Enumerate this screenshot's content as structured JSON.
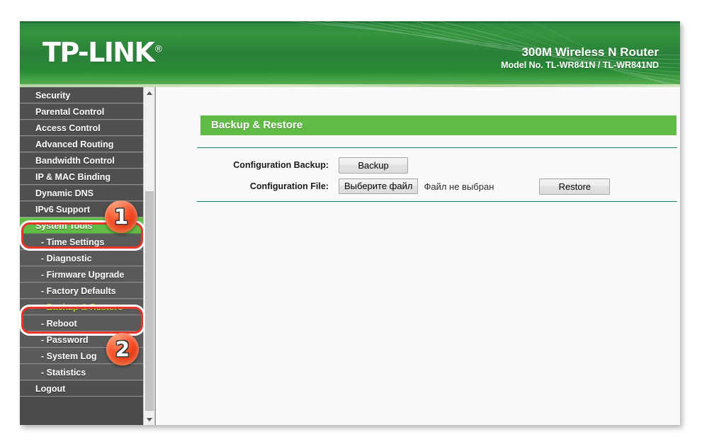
{
  "header": {
    "logo_text": "TP-LINK",
    "logo_registered": "®",
    "product_title": "300M Wireless N Router",
    "model_line": "Model No. TL-WR841N / TL-WR841ND"
  },
  "sidebar": {
    "items": [
      {
        "label": "Security",
        "type": "top",
        "state": "normal"
      },
      {
        "label": "Parental Control",
        "type": "top",
        "state": "normal"
      },
      {
        "label": "Access Control",
        "type": "top",
        "state": "normal"
      },
      {
        "label": "Advanced Routing",
        "type": "top",
        "state": "normal"
      },
      {
        "label": "Bandwidth Control",
        "type": "top",
        "state": "normal"
      },
      {
        "label": "IP & MAC Binding",
        "type": "top",
        "state": "normal"
      },
      {
        "label": "Dynamic DNS",
        "type": "top",
        "state": "normal"
      },
      {
        "label": "IPv6 Support",
        "type": "top",
        "state": "normal"
      },
      {
        "label": "System Tools",
        "type": "top",
        "state": "active"
      },
      {
        "label": "- Time Settings",
        "type": "sub",
        "state": "normal"
      },
      {
        "label": "- Diagnostic",
        "type": "sub",
        "state": "normal"
      },
      {
        "label": "- Firmware Upgrade",
        "type": "sub",
        "state": "normal"
      },
      {
        "label": "- Factory Defaults",
        "type": "sub",
        "state": "normal"
      },
      {
        "label": "- Backup & Restore",
        "type": "sub",
        "state": "sub-active"
      },
      {
        "label": "- Reboot",
        "type": "sub",
        "state": "normal"
      },
      {
        "label": "- Password",
        "type": "sub",
        "state": "normal"
      },
      {
        "label": "- System Log",
        "type": "sub",
        "state": "normal"
      },
      {
        "label": "- Statistics",
        "type": "sub",
        "state": "normal"
      },
      {
        "label": "Logout",
        "type": "top",
        "state": "normal"
      }
    ],
    "scrollbar": {
      "up_arrow_icon": "triangle-up-icon",
      "down_arrow_icon": "triangle-down-icon"
    }
  },
  "main": {
    "section_title": "Backup & Restore",
    "rows": [
      {
        "label": "Configuration Backup:",
        "button": "Backup"
      },
      {
        "label": "Configuration File:",
        "file_button": "Выберите файл",
        "file_status": "Файл не выбран",
        "restore_button": "Restore"
      }
    ]
  },
  "annotations": [
    {
      "badge": "1",
      "target": "System Tools"
    },
    {
      "badge": "2",
      "target": "- Backup & Restore"
    }
  ],
  "colors": {
    "brand_green": "#62bb46",
    "header_green": "#2a8038",
    "annotation_red": "#e8352a",
    "sidebar_gray": "#565656",
    "sub_active_text": "#a8d03a"
  }
}
